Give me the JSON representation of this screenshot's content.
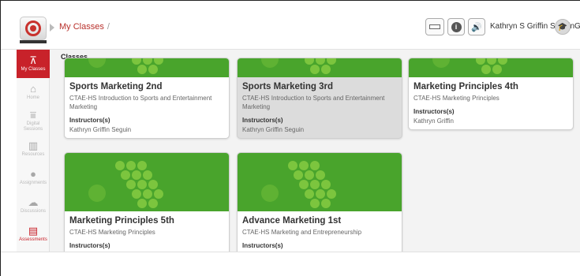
{
  "header": {
    "breadcrumb": "My Classes",
    "breadcrumb_sep": "/",
    "user_name": "Kathryn S Griffin Seguin",
    "tools": [
      {
        "name": "rectangle-tool-icon"
      },
      {
        "name": "info-icon",
        "glyph": "i"
      },
      {
        "name": "speaker-icon",
        "glyph": "🔊"
      }
    ],
    "avatar_icon": "graduation-cap-icon",
    "more": "G"
  },
  "sidebar": {
    "items": [
      {
        "label": "My Classes",
        "icon": "presentation-board-icon",
        "glyph": "⊼",
        "active": true
      },
      {
        "label": "Home",
        "icon": "home-icon",
        "glyph": "⌂",
        "active": false
      },
      {
        "label": "Digital Sessions",
        "icon": "digital-sessions-icon",
        "glyph": "⩸",
        "active": false
      },
      {
        "label": "Resources",
        "icon": "books-icon",
        "glyph": "▥",
        "active": false
      },
      {
        "label": "Assignments",
        "icon": "assignments-icon",
        "glyph": "●",
        "active": false
      },
      {
        "label": "Discussions",
        "icon": "chat-bubbles-icon",
        "glyph": "☁",
        "active": false
      },
      {
        "label": "Assessments",
        "icon": "clipboard-icon",
        "glyph": "▤",
        "active": false
      }
    ]
  },
  "main": {
    "section_title": "Classes",
    "cards": [
      {
        "title": "Sports Marketing 2nd",
        "subtitle": "CTAE-HS Introduction to Sports and Entertainment Marketing",
        "instructors_label": "Instructors(s)",
        "instructor": "Kathryn Griffin Seguin"
      },
      {
        "title": "Sports Marketing 3rd",
        "subtitle": "CTAE-HS Introduction to Sports and Entertainment Marketing",
        "instructors_label": "Instructors(s)",
        "instructor": "Kathryn Griffin Seguin"
      },
      {
        "title": "Marketing Principles 4th",
        "subtitle": "CTAE-HS Marketing Principles",
        "instructors_label": "Instructors(s)",
        "instructor": "Kathryn Griffin"
      },
      {
        "title": "Marketing Principles 5th",
        "subtitle": "CTAE-HS Marketing Principles",
        "instructors_label": "Instructors(s)",
        "instructor": ""
      },
      {
        "title": "Advance Marketing 1st",
        "subtitle": "CTAE-HS Marketing and Entrepreneurship",
        "instructors_label": "Instructors(s)",
        "instructor": ""
      }
    ]
  },
  "colors": {
    "brand_red": "#c8222a",
    "banner_green": "#49a42c",
    "dot_green": "#7cc53e"
  }
}
